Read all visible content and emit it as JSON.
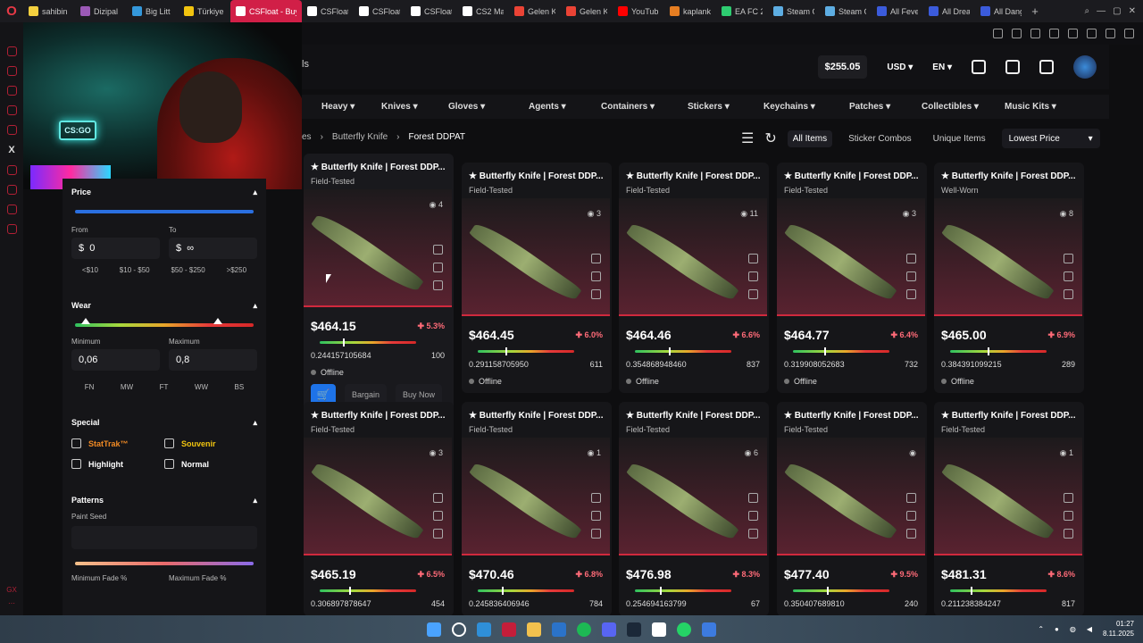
{
  "browser": {
    "tabs": [
      {
        "label": "sahibin",
        "color": "#f4d03f",
        "active": false
      },
      {
        "label": "Dizipal",
        "color": "#9b59b6",
        "active": false
      },
      {
        "label": "Big Litt",
        "color": "#3498db",
        "active": false
      },
      {
        "label": "Türkiye",
        "color": "#f1c40f",
        "active": false
      },
      {
        "label": "CSFloat - Buy",
        "color": "#ffffff",
        "active": true
      },
      {
        "label": "CSFloat",
        "color": "#ffffff",
        "active": false
      },
      {
        "label": "CSFloat",
        "color": "#ffffff",
        "active": false
      },
      {
        "label": "CSFloat",
        "color": "#ffffff",
        "active": false
      },
      {
        "label": "CS2 Ma",
        "color": "#ffffff",
        "active": false
      },
      {
        "label": "Gelen K",
        "color": "#ea4335",
        "active": false
      },
      {
        "label": "Gelen K",
        "color": "#ea4335",
        "active": false
      },
      {
        "label": "YouTub",
        "color": "#ff0000",
        "active": false
      },
      {
        "label": "kaplank",
        "color": "#e67e22",
        "active": false
      },
      {
        "label": "EA FC 2",
        "color": "#2ecc71",
        "active": false
      },
      {
        "label": "Steam C",
        "color": "#5dade2",
        "active": false
      },
      {
        "label": "Steam C",
        "color": "#5dade2",
        "active": false
      },
      {
        "label": "All Feve",
        "color": "#3b5bdb",
        "active": false
      },
      {
        "label": "All Drea",
        "color": "#3b5bdb",
        "active": false
      },
      {
        "label": "All Dang",
        "color": "#3b5bdb",
        "active": false
      }
    ],
    "new_tab": "+"
  },
  "header": {
    "nav_stub": "ls",
    "balance": "$255.05",
    "currency": "USD",
    "language": "EN"
  },
  "categories": [
    "Heavy",
    "Knives",
    "Gloves",
    "Agents",
    "Containers",
    "Stickers",
    "Keychains",
    "Patches",
    "Collectibles",
    "Music Kits"
  ],
  "breadcrumb": {
    "prev": "es",
    "parent": "Butterfly Knife",
    "current": "Forest DDPAT"
  },
  "list_tools": {
    "tabs": [
      "All Items",
      "Sticker Combos",
      "Unique Items"
    ],
    "sort": "Lowest Price"
  },
  "filters": {
    "price": {
      "title": "Price",
      "from_label": "From",
      "to_label": "To",
      "from_value": "0",
      "to_value": "∞",
      "currency": "$",
      "chips": [
        "<$10",
        "$10 - $50",
        "$50 - $250",
        ">$250"
      ]
    },
    "wear": {
      "title": "Wear",
      "min_label": "Minimum",
      "max_label": "Maximum",
      "min_value": "0,06",
      "max_value": "0,8",
      "min_fraction": 0.06,
      "max_fraction": 0.8,
      "chips": [
        "FN",
        "MW",
        "FT",
        "WW",
        "BS"
      ]
    },
    "special": {
      "title": "Special",
      "options": [
        {
          "label": "StatTrak™",
          "color": "#f08a24"
        },
        {
          "label": "Souvenir",
          "color": "#f1c40f"
        },
        {
          "label": "Highlight",
          "color": "#ffffff"
        },
        {
          "label": "Normal",
          "color": "#ffffff"
        }
      ]
    },
    "patterns": {
      "title": "Patterns",
      "seed_label": "Paint Seed",
      "fade_min_label": "Minimum Fade %",
      "fade_max_label": "Maximum Fade %"
    }
  },
  "hover_actions": {
    "bargain": "Bargain",
    "buy_now": "Buy Now"
  },
  "items": [
    {
      "name": "★ Butterfly Knife | Forest DDPAT (Field-Tested)",
      "wear": "Field-Tested",
      "views": "4",
      "price": "$464.15",
      "discount": "5.3%",
      "float": "0.244157105684",
      "float_value": 0.244157105684,
      "seed": "100",
      "status": "Offline",
      "hover": true
    },
    {
      "name": "★ Butterfly Knife | Forest DDPAT (Field-Tested)",
      "wear": "Field-Tested",
      "views": "3",
      "price": "$464.45",
      "discount": "6.0%",
      "float": "0.291158705950",
      "float_value": 0.29115870595,
      "seed": "611",
      "status": "Offline",
      "hover": false
    },
    {
      "name": "★ Butterfly Knife | Forest DDPAT (Field-Tested)",
      "wear": "Field-Tested",
      "views": "11",
      "price": "$464.46",
      "discount": "6.6%",
      "float": "0.354868948460",
      "float_value": 0.35486894846,
      "seed": "837",
      "status": "Offline",
      "hover": false
    },
    {
      "name": "★ Butterfly Knife | Forest DDPAT (Field-Tested)",
      "wear": "Field-Tested",
      "views": "3",
      "price": "$464.77",
      "discount": "6.4%",
      "float": "0.319908052683",
      "float_value": 0.319908052683,
      "seed": "732",
      "status": "Offline",
      "hover": false
    },
    {
      "name": "★ Butterfly Knife | Forest DDPAT (Well-Worn)",
      "wear": "Well-Worn",
      "views": "8",
      "price": "$465.00",
      "discount": "6.9%",
      "float": "0.384391099215",
      "float_value": 0.384391099215,
      "seed": "289",
      "status": "Offline",
      "hover": false
    },
    {
      "name": "★ Butterfly Knife | Forest DDPAT (Field-Tested)",
      "wear": "Field-Tested",
      "views": "3",
      "price": "$465.19",
      "discount": "6.5%",
      "float": "0.306897878647",
      "float_value": 0.306897878647,
      "seed": "454",
      "status": "",
      "hover": false
    },
    {
      "name": "★ Butterfly Knife | Forest DDPAT (Field-Tested)",
      "wear": "Field-Tested",
      "views": "1",
      "price": "$470.46",
      "discount": "6.8%",
      "float": "0.245836406946",
      "float_value": 0.245836406946,
      "seed": "784",
      "status": "",
      "hover": false
    },
    {
      "name": "★ Butterfly Knife | Forest DDPAT (Field-Tested)",
      "wear": "Field-Tested",
      "views": "6",
      "price": "$476.98",
      "discount": "8.3%",
      "float": "0.254694163799",
      "float_value": 0.254694163799,
      "seed": "67",
      "status": "",
      "hover": false
    },
    {
      "name": "★ Butterfly Knife | Forest DDPAT (Field-Tested)",
      "wear": "Field-Tested",
      "views": "",
      "price": "$477.40",
      "discount": "9.5%",
      "float": "0.350407689810",
      "float_value": 0.35040768981,
      "seed": "240",
      "status": "",
      "hover": false
    },
    {
      "name": "★ Butterfly Knife | Forest DDPAT (Field-Tested)",
      "wear": "Field-Tested",
      "views": "1",
      "price": "$481.31",
      "discount": "8.6%",
      "float": "0.211238384247",
      "float_value": 0.211238384247,
      "seed": "817",
      "status": "",
      "hover": false
    }
  ],
  "taskbar": {
    "time": "01:27",
    "date": "8.11.2025"
  },
  "colors": {
    "accent": "#1e73e8",
    "brand": "#d11f47",
    "danger": "#d1293d"
  }
}
